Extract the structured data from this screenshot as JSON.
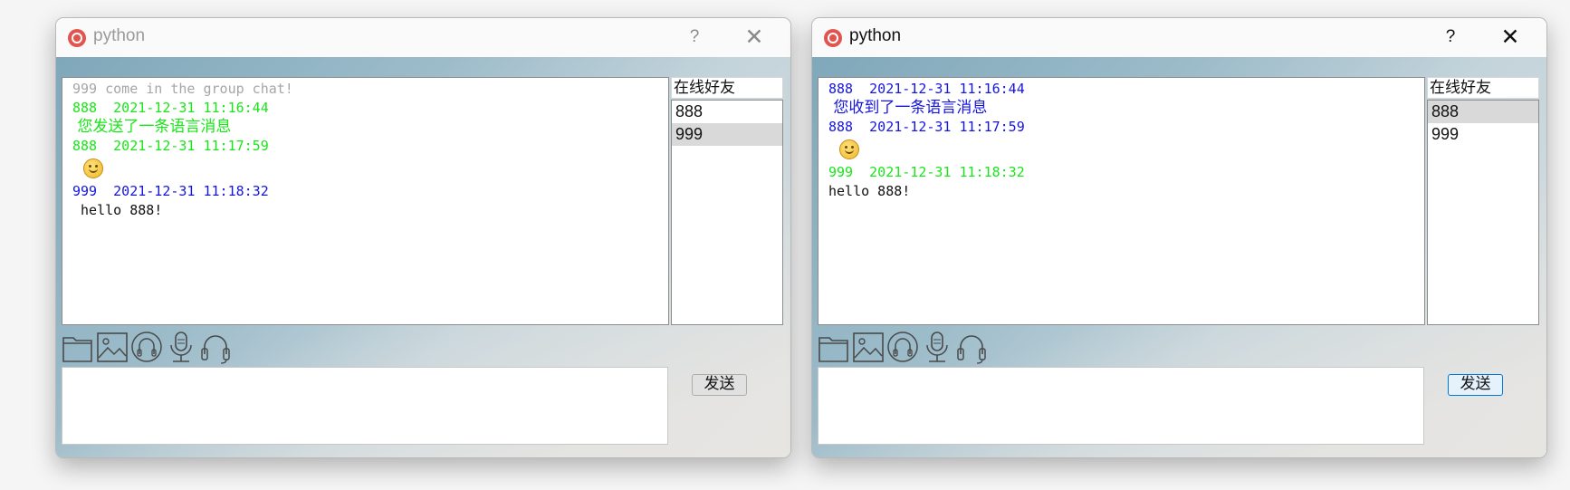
{
  "windows": [
    {
      "title": "python",
      "help": "?",
      "close": "✕",
      "friends_header": "在线好友",
      "friends": [
        "888",
        "999"
      ],
      "selected_friend": "999",
      "send_label": "发送",
      "chat": [
        {
          "type": "text",
          "color": "gray",
          "text": "999 come in the group chat!"
        },
        {
          "type": "text",
          "color": "green",
          "text": "888  2021-12-31 11:16:44"
        },
        {
          "type": "text",
          "color": "green",
          "cn": true,
          "text": " 您发送了一条语言消息"
        },
        {
          "type": "text",
          "color": "green",
          "text": "888  2021-12-31 11:17:59"
        },
        {
          "type": "emoji",
          "icon": "smiley-emoji-icon"
        },
        {
          "type": "text",
          "color": "blue",
          "text": "999  2021-12-31 11:18:32"
        },
        {
          "type": "text",
          "color": "black",
          "text": " hello 888!"
        }
      ]
    },
    {
      "title": "python",
      "help": "?",
      "close": "✕",
      "friends_header": "在线好友",
      "friends": [
        "888",
        "999"
      ],
      "selected_friend": "888",
      "send_label": "发送",
      "chat": [
        {
          "type": "text",
          "color": "blue",
          "text": "888  2021-12-31 11:16:44"
        },
        {
          "type": "text",
          "color": "blue",
          "cn": true,
          "text": " 您收到了一条语言消息"
        },
        {
          "type": "text",
          "color": "blue",
          "text": "888  2021-12-31 11:17:59"
        },
        {
          "type": "emoji",
          "icon": "smiley-emoji-icon"
        },
        {
          "type": "text",
          "color": "green",
          "text": "999  2021-12-31 11:18:32"
        },
        {
          "type": "text",
          "color": "black",
          "text": "hello 888!"
        }
      ]
    }
  ],
  "toolbar_icons": [
    "folder-icon",
    "image-icon",
    "headset-outline-icon",
    "microphone-icon",
    "headphones-icon"
  ],
  "colors": {
    "gray": "#a6a6a6",
    "green": "#19e619",
    "blue": "#1515e0",
    "black": "#111111"
  }
}
